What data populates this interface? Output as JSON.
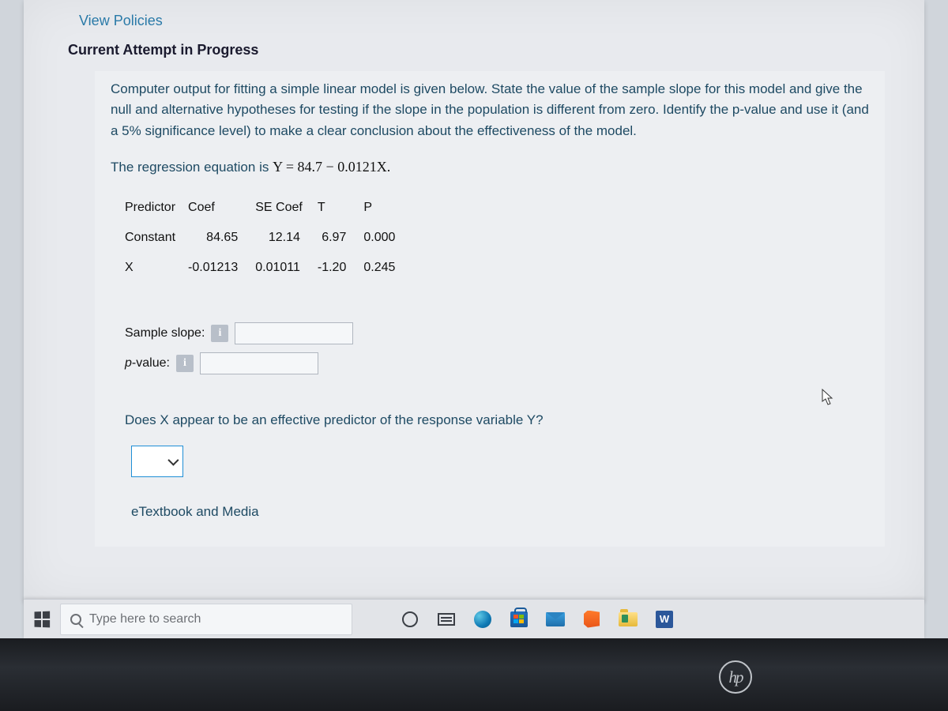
{
  "links": {
    "view_policies": "View Policies"
  },
  "heading": "Current Attempt in Progress",
  "prompt": "Computer output for fitting a simple linear model is given below. State the value of the sample slope for this model and give the null and alternative hypotheses for testing if the slope in the population is different from zero. Identify the p-value and use it (and a 5% significance level) to make a clear conclusion about the effectiveness of the model.",
  "equation_label": "The regression equation is ",
  "equation_math": "Y = 84.7 − 0.0121X.",
  "table": {
    "headers": [
      "Predictor",
      "Coef",
      "SE Coef",
      "T",
      "P"
    ],
    "rows": [
      {
        "predictor": "Constant",
        "coef": "84.65",
        "se": "12.14",
        "t": "6.97",
        "p": "0.000"
      },
      {
        "predictor": "X",
        "coef": "-0.01213",
        "se": "0.01011",
        "t": "-1.20",
        "p": "0.245"
      }
    ]
  },
  "inputs": {
    "sample_slope_label": "Sample slope:",
    "pvalue_label_prefix": "p",
    "pvalue_label_suffix": "-value:",
    "info_char": "i"
  },
  "question2": "Does X appear to be an effective predictor of the response variable Y?",
  "etextbook": "eTextbook and Media",
  "taskbar": {
    "search_placeholder": "Type here to search",
    "word_letter": "W"
  },
  "brand": "hp"
}
